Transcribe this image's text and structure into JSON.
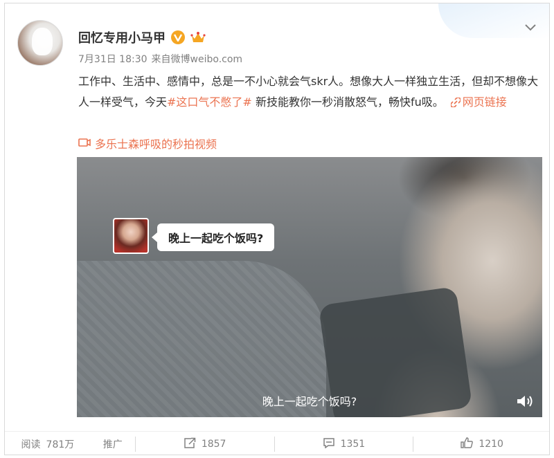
{
  "post": {
    "username": "回忆专用小马甲",
    "date": "7月31日 18:30",
    "source_prefix": "来自",
    "source": "微博weibo.com",
    "text_part1": "工作中、生活中、感情中，总是一不小心就会气skr人。想像大人一样独立生活，但却不想像大人一样受气，今天",
    "topic": "#这口气不憋了#",
    "text_part2": "新技能教你一秒消散怒气，畅快fu吸。",
    "web_link_label": "网页链接",
    "video_link_label": "多乐士森呼吸的秒拍视频"
  },
  "video": {
    "chat_message": "晚上一起吃个饭吗?",
    "subtitle": "晚上一起吃个饭吗?"
  },
  "actions": {
    "read_label": "阅读",
    "read_count": "781万",
    "promote_label": "推广",
    "forward_count": "1857",
    "comment_count": "1351",
    "like_count": "1210"
  },
  "colors": {
    "accent_link": "#eb7350",
    "verified_badge": "#f5a623",
    "text_primary": "#333333",
    "text_secondary": "#808080"
  },
  "icons": [
    "chevron-down-icon",
    "verified-v-icon",
    "crown-icon",
    "link-icon",
    "video-icon",
    "volume-icon",
    "forward-icon",
    "comment-icon",
    "like-icon"
  ]
}
